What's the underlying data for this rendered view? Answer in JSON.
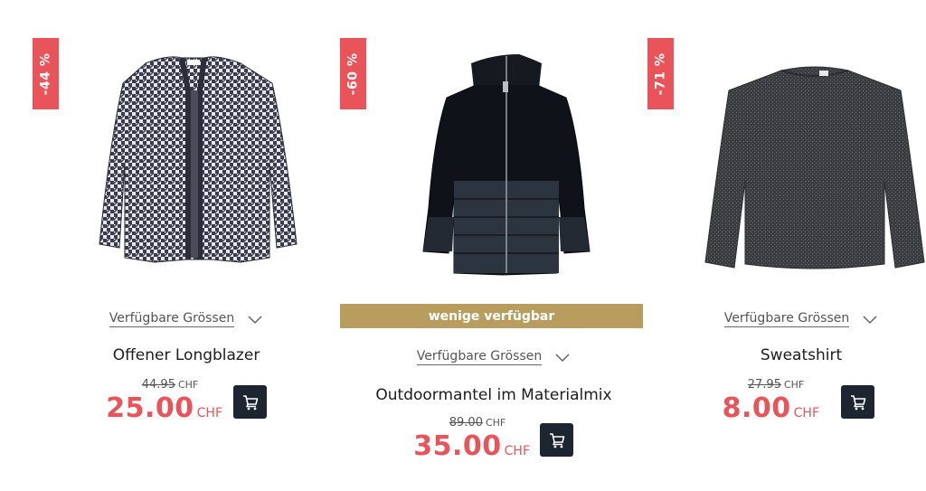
{
  "colors": {
    "sale_badge": "#e9545a",
    "sale_price": "#e9545a",
    "availability_banner": "#b99d5e",
    "cart_button": "#1c2530"
  },
  "icons": {
    "cart": "shopping-cart-icon",
    "dropdown": "chevron-down-icon"
  },
  "products": [
    {
      "discount_badge": "-44 %",
      "sizes_label": "Verfügbare Grössen",
      "name": "Offener Longblazer",
      "old_price": "44.95",
      "old_currency": "CHF",
      "price": "25.00",
      "currency": "CHF"
    },
    {
      "discount_badge": "-60 %",
      "availability": "wenige verfügbar",
      "sizes_label": "Verfügbare Grössen",
      "name": "Outdoormantel im Materialmix",
      "old_price": "89.00",
      "old_currency": "CHF",
      "price": "35.00",
      "currency": "CHF"
    },
    {
      "discount_badge": "-71 %",
      "sizes_label": "Verfügbare Grössen",
      "name": "Sweatshirt",
      "old_price": "27.95",
      "old_currency": "CHF",
      "price": "8.00",
      "currency": "CHF"
    }
  ]
}
